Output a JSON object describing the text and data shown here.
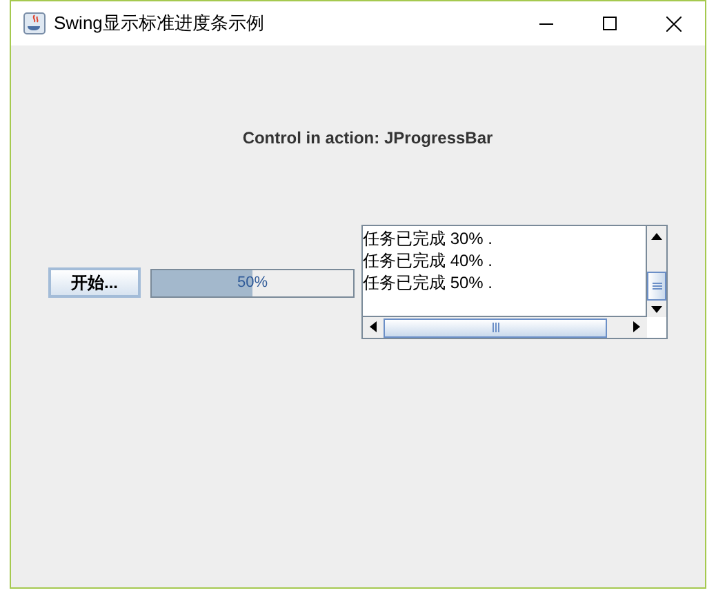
{
  "window": {
    "title": "Swing显示标准进度条示例"
  },
  "heading": "Control in action: JProgressBar",
  "start_button": "开始...",
  "progress": {
    "level": 0.5,
    "text": "50%"
  },
  "log": [
    "任务已完成 30% .",
    "任务已完成 40% .",
    "任务已完成 50% ."
  ]
}
